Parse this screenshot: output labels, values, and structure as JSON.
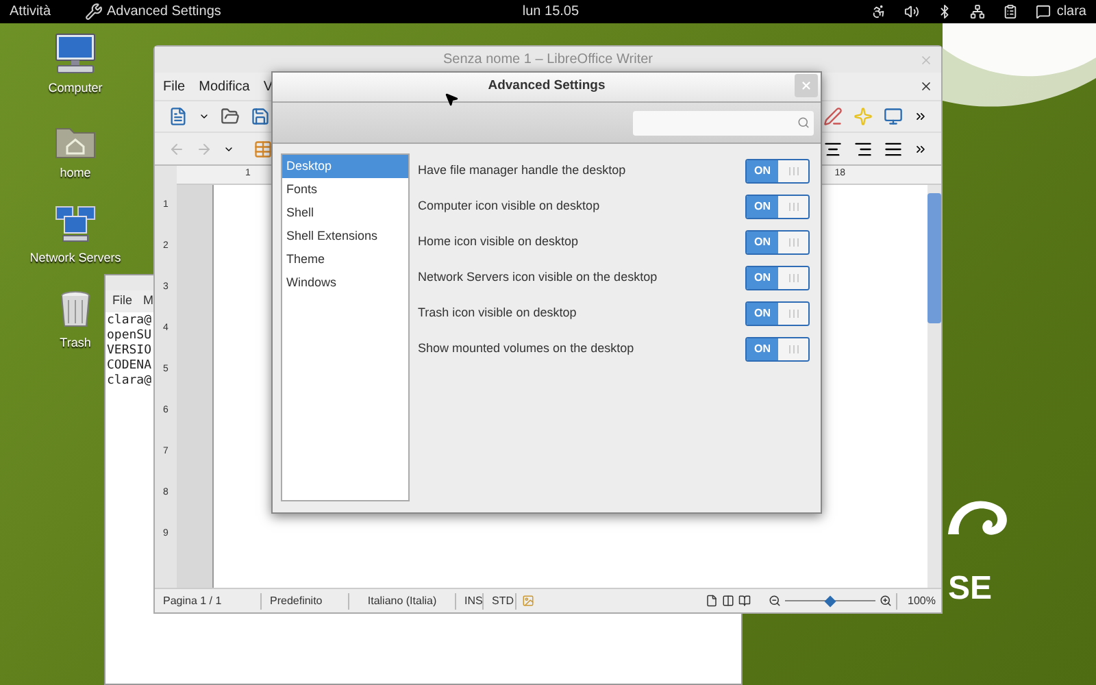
{
  "top_bar": {
    "activities": "Attività",
    "app_name": "Advanced Settings",
    "clock": "lun 15.05",
    "user": "clara"
  },
  "desktop_icons": [
    {
      "label": "Computer",
      "kind": "computer"
    },
    {
      "label": "home",
      "kind": "folder"
    },
    {
      "label": "Network Servers",
      "kind": "network"
    },
    {
      "label": "Trash",
      "kind": "trash"
    }
  ],
  "terminal": {
    "menu": [
      "File",
      "M"
    ],
    "lines": [
      "clara@",
      "openSU",
      "VERSIO",
      "CODENA",
      "clara@"
    ]
  },
  "writer": {
    "title": "Senza nome 1 – LibreOffice Writer",
    "menu": [
      "File",
      "Modifica",
      "V"
    ],
    "ruler_labels": [
      "1",
      "18"
    ],
    "vertical_ruler": [
      "1",
      "2",
      "3",
      "4",
      "5",
      "6",
      "7",
      "8",
      "9"
    ],
    "status_bar": [
      "Pagina 1 / 1",
      "Predefinito",
      "Italiano (Italia)",
      "INS",
      "STD"
    ],
    "zoom_slider": {
      "level": 0.5
    },
    "zoom": "100%"
  },
  "dialog": {
    "title": "Advanced Settings",
    "categories": [
      {
        "label": "Desktop",
        "selected": true
      },
      {
        "label": "Fonts",
        "selected": false
      },
      {
        "label": "Shell",
        "selected": false
      },
      {
        "label": "Shell Extensions",
        "selected": false
      },
      {
        "label": "Theme",
        "selected": false
      },
      {
        "label": "Windows",
        "selected": false
      }
    ],
    "settings": [
      {
        "label": "Have file manager handle the desktop",
        "on": true,
        "state_text": "ON"
      },
      {
        "label": "Computer icon visible on desktop",
        "on": true,
        "state_text": "ON"
      },
      {
        "label": "Home icon visible on desktop",
        "on": true,
        "state_text": "ON"
      },
      {
        "label": "Network Servers icon visible on the desktop",
        "on": true,
        "state_text": "ON"
      },
      {
        "label": "Trash icon visible on desktop",
        "on": true,
        "state_text": "ON"
      },
      {
        "label": "Show mounted volumes on the desktop",
        "on": true,
        "state_text": "ON"
      }
    ]
  },
  "logo_text": "SE"
}
